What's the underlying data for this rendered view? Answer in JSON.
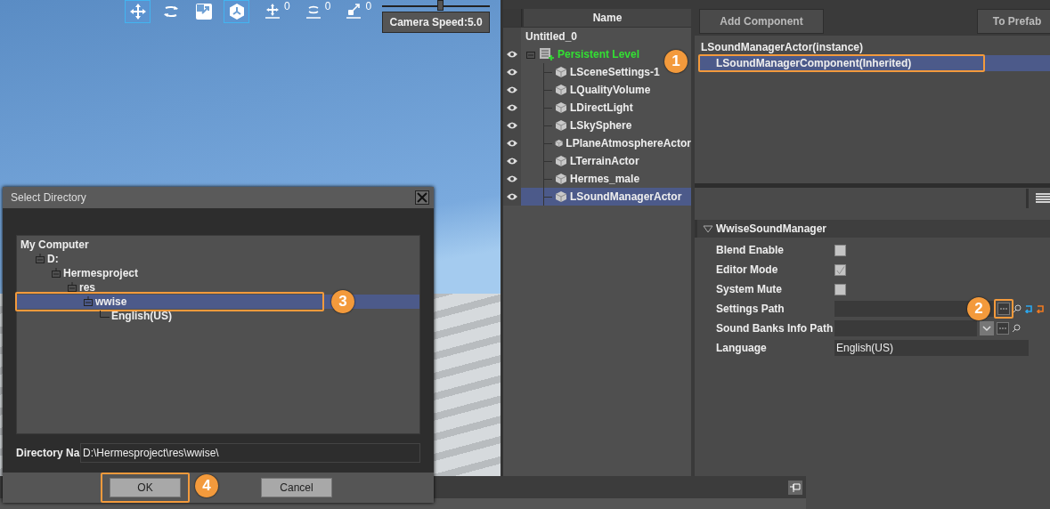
{
  "viewport_toolbar": {
    "tools": [
      {
        "kind": "move",
        "selected": true
      },
      {
        "kind": "rotate",
        "selected": false
      },
      {
        "kind": "scale",
        "selected": false
      },
      {
        "kind": "space",
        "selected": true
      }
    ],
    "snaps": [
      {
        "kind": "move",
        "value": "0"
      },
      {
        "kind": "rotate",
        "value": "0"
      },
      {
        "kind": "scale",
        "value": "0"
      }
    ],
    "camera_speed": {
      "label": "Camera Speed:5.0",
      "level": 0.54
    }
  },
  "outliner": {
    "column": "Name",
    "root": "Untitled_0",
    "level": {
      "label": "Persistent Level",
      "children": [
        {
          "label": "LSceneSettings-1",
          "selected": false
        },
        {
          "label": "LQualityVolume",
          "selected": false
        },
        {
          "label": "LDirectLight",
          "selected": false
        },
        {
          "label": "LSkySphere",
          "selected": false
        },
        {
          "label": "LPlaneAtmosphereActor",
          "selected": false
        },
        {
          "label": "LTerrainActor",
          "selected": false
        },
        {
          "label": "Hermes_male",
          "selected": false
        },
        {
          "label": "LSoundManagerActor",
          "selected": true
        }
      ]
    }
  },
  "details": {
    "buttons": [
      "Add Component",
      "To Prefab"
    ],
    "components": {
      "label": "LSoundManagerActor(instance)",
      "children": [
        {
          "label": "LSoundManagerComponent(Inherited)",
          "selected": true,
          "callout": "1"
        }
      ]
    },
    "section": {
      "title": "WwiseSoundManager",
      "expanded": true,
      "properties": [
        {
          "kind": "checkbox",
          "label": "Blend Enable",
          "checked": false
        },
        {
          "kind": "checkbox",
          "label": "Editor Mode",
          "checked": true
        },
        {
          "kind": "checkbox",
          "label": "System Mute",
          "checked": false
        },
        {
          "kind": "path",
          "label": "Settings Path",
          "callout": "2"
        },
        {
          "kind": "dropdown",
          "label": "Sound Banks Info Path"
        },
        {
          "kind": "text",
          "label": "Language",
          "value": "English(US)"
        }
      ]
    }
  },
  "dialog": {
    "title": "Select Directory",
    "tree": [
      {
        "label": "My Computer",
        "selected": false,
        "children": [
          {
            "label": "D:",
            "selected": false,
            "children": [
              {
                "label": "Hermesproject",
                "selected": false,
                "children": [
                  {
                    "label": "res",
                    "selected": false,
                    "children": [
                      {
                        "label": "wwise",
                        "selected": true,
                        "callout": "3",
                        "children": [
                          {
                            "label": "English(US)",
                            "selected": false
                          }
                        ]
                      }
                    ]
                  }
                ]
              }
            ]
          }
        ]
      }
    ],
    "directory_label": "Directory Na",
    "directory_value": "D:\\Hermesproject\\res\\wwise\\",
    "buttons": [
      {
        "label": "OK",
        "callout": "4"
      },
      {
        "label": "Cancel"
      }
    ]
  }
}
